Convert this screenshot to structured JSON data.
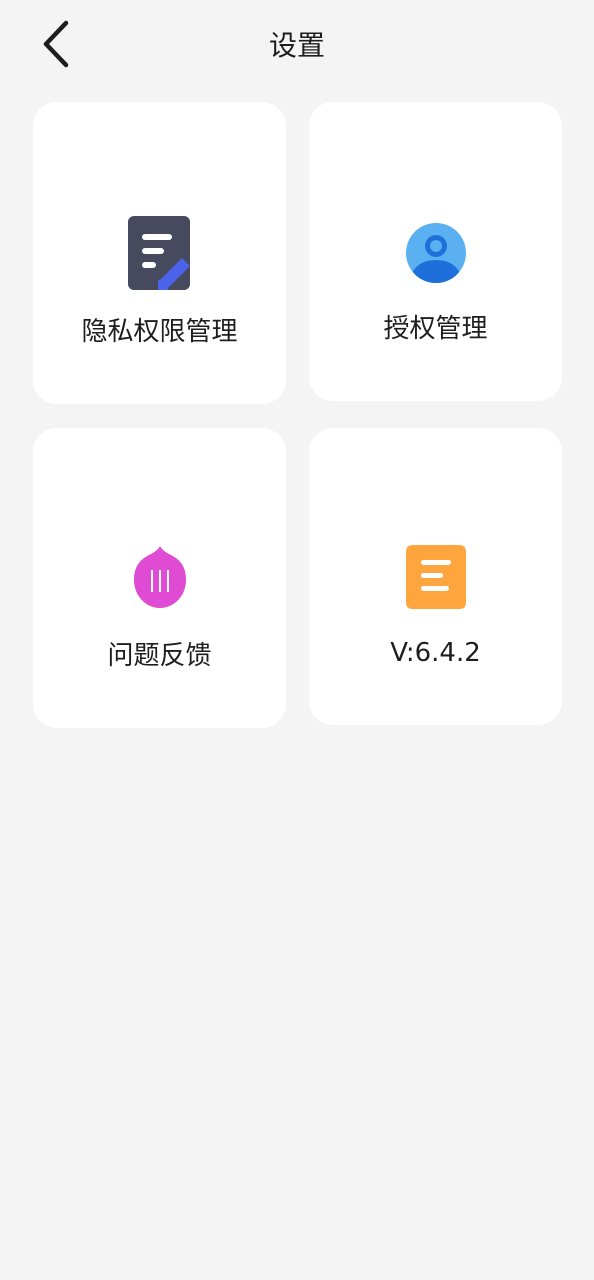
{
  "header": {
    "title": "设置",
    "back_icon": "chevron-left-icon"
  },
  "cards": [
    {
      "label": "隐私权限管理",
      "icon": "document-edit-icon",
      "icon_colors": [
        "#474a5e",
        "#4b63ea"
      ]
    },
    {
      "label": "授权管理",
      "icon": "user-avatar-icon",
      "icon_colors": [
        "#5ab0f0",
        "#1e6fd9"
      ]
    },
    {
      "label": "问题反馈",
      "icon": "feedback-drop-icon",
      "icon_colors": [
        "#e04bd3"
      ]
    },
    {
      "label": "V:6.4.2",
      "icon": "version-list-icon",
      "icon_colors": [
        "#ffa53e"
      ]
    }
  ],
  "colors": {
    "background": "#f4f4f4",
    "card": "#ffffff",
    "text": "#1e1e1e"
  }
}
